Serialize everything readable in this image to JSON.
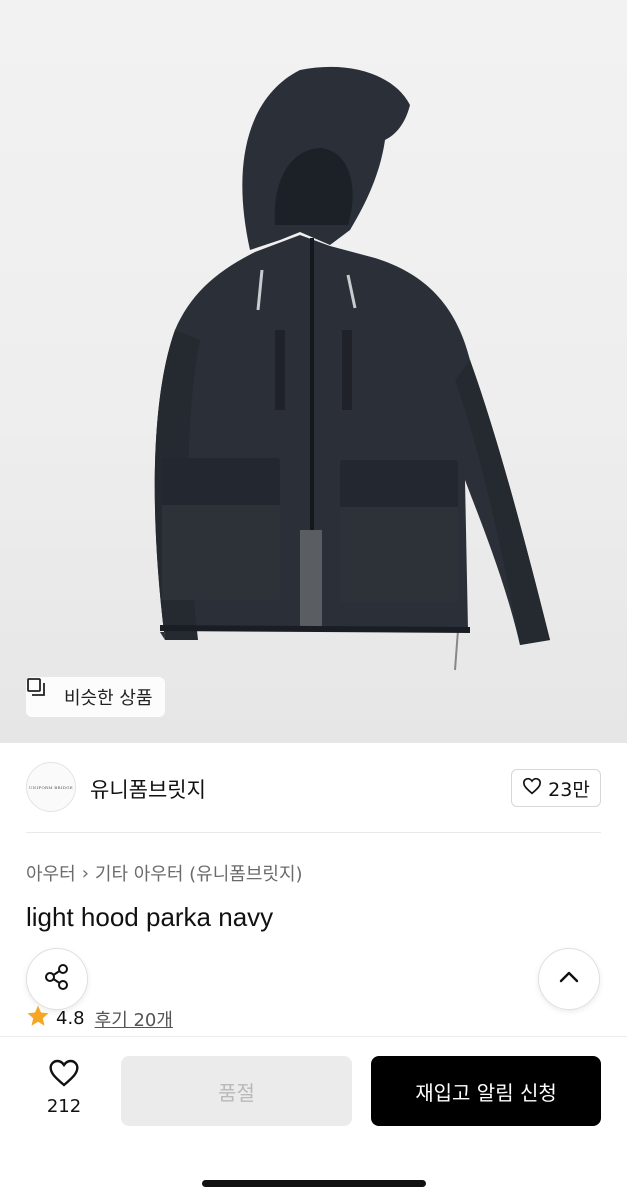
{
  "product": {
    "image_alt": "navy hooded parka",
    "similar_label": "비슷한 상품",
    "brand_name": "유니폼브릿지",
    "brand_logo_text": "UNIFORM BRIDGE",
    "like_count": "23만",
    "breadcrumb": [
      "아우터",
      "기타 아우터 (유니폼브릿지)"
    ],
    "title": "light hood parka navy",
    "rating": "4.8",
    "review_label": "후기 20개"
  },
  "bottom_bar": {
    "wish_count": "212",
    "soldout_label": "품절",
    "restock_label": "재입고 알림 신청"
  },
  "colors": {
    "accent_star": "#f5a623",
    "primary_button": "#000000",
    "disabled_button": "#ebebeb",
    "jacket": "#2b3038"
  }
}
